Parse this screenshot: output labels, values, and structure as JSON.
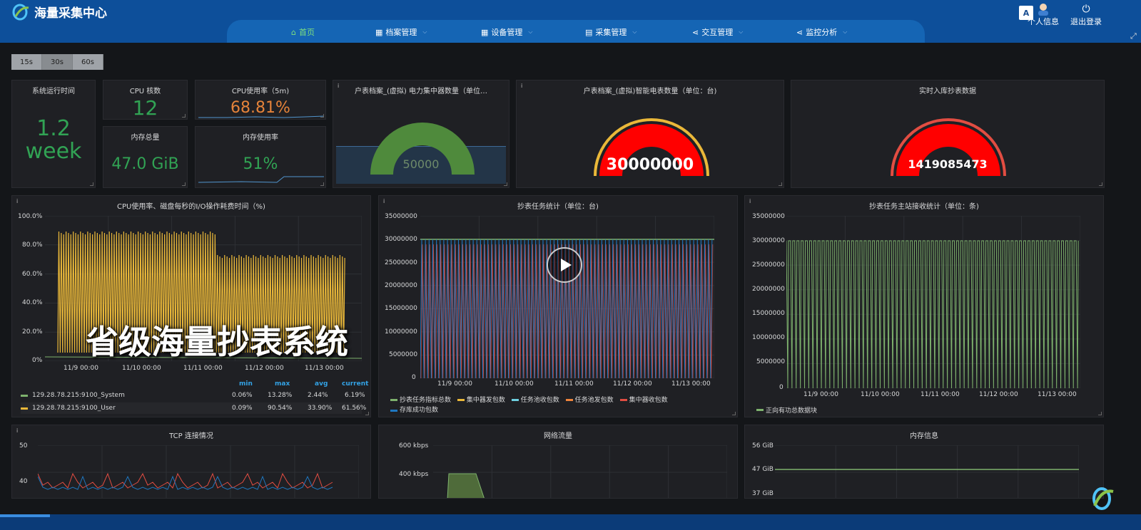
{
  "app": {
    "title": "海量采集中心"
  },
  "nav": [
    {
      "label": "首页",
      "active": true
    },
    {
      "label": "档案管理"
    },
    {
      "label": "设备管理"
    },
    {
      "label": "采集管理"
    },
    {
      "label": "交互管理"
    },
    {
      "label": "监控分析"
    }
  ],
  "topRight": {
    "translate": "A",
    "profile": "个人信息",
    "logout": "退出登录"
  },
  "ranges": [
    "15s",
    "30s",
    "60s"
  ],
  "stats": {
    "uptime": {
      "title": "系统运行时间",
      "value": "1.2 week",
      "line1": "1.2",
      "line2": "week"
    },
    "cpuCores": {
      "title": "CPU 核数",
      "value": "12"
    },
    "cpuUsage": {
      "title": "CPU使用率（5m)",
      "value": "68.81%"
    },
    "memTotal": {
      "title": "内存总量",
      "value": "47.0 GiB"
    },
    "memUsage": {
      "title": "内存使用率",
      "value": "51%"
    }
  },
  "gauges": {
    "concentrators": {
      "title": "户表档案_(虚拟) 电力集中器数量（单位…",
      "value": "50000",
      "color": "#4f8a3c"
    },
    "meters": {
      "title": "户表档案_(虚拟)智能电表数量（单位：台)",
      "value": "30000000",
      "color": "#ff0000"
    },
    "realtime": {
      "title": "实时入库抄表数据",
      "value": "1419085473",
      "color": "#ff0000"
    }
  },
  "cpuChart": {
    "title": "CPU使用率、磁盘每秒的I/O操作耗费时间（%)",
    "yTicks": [
      "100.0%",
      "80.0%",
      "60.0%",
      "40.0%",
      "20.0%",
      "0%"
    ],
    "xTicks": [
      "11/9 00:00",
      "11/10 00:00",
      "11/11 00:00",
      "11/12 00:00",
      "11/13 00:00"
    ],
    "legendHeader": [
      "min",
      "max",
      "avg",
      "current"
    ],
    "legend": [
      {
        "name": "129.28.78.215:9100_System",
        "min": "0.06%",
        "max": "13.28%",
        "avg": "2.44%",
        "current": "6.19%",
        "color": "#7eb26d"
      },
      {
        "name": "129.28.78.215:9100_User",
        "min": "0.09%",
        "max": "90.54%",
        "avg": "33.90%",
        "current": "61.56%",
        "color": "#eab839"
      }
    ]
  },
  "taskChart": {
    "title": "抄表任务统计（单位：台)",
    "yTicks": [
      "35000000",
      "30000000",
      "25000000",
      "20000000",
      "15000000",
      "10000000",
      "5000000",
      "0"
    ],
    "xTicks": [
      "11/9 00:00",
      "11/10 00:00",
      "11/11 00:00",
      "11/12 00:00",
      "11/13 00:00"
    ],
    "legend": [
      {
        "name": "抄表任务指标总数",
        "color": "#7eb26d"
      },
      {
        "name": "集中器发包数",
        "color": "#eab839"
      },
      {
        "name": "任务池收包数",
        "color": "#6ed0e0"
      },
      {
        "name": "任务池发包数",
        "color": "#ef843c"
      },
      {
        "name": "集中器收包数",
        "color": "#e24d42"
      },
      {
        "name": "存库成功包数",
        "color": "#1f78c1"
      }
    ]
  },
  "masterChart": {
    "title": "抄表任务主站接收统计（单位：条)",
    "yTicks": [
      "35000000",
      "30000000",
      "25000000",
      "20000000",
      "15000000",
      "10000000",
      "5000000",
      "0"
    ],
    "xTicks": [
      "11/9 00:00",
      "11/10 00:00",
      "11/11 00:00",
      "11/12 00:00",
      "11/13 00:00"
    ],
    "legend": [
      {
        "name": "正向有功总数据块",
        "color": "#7eb26d"
      }
    ]
  },
  "tcpChart": {
    "title": "TCP 连接情况",
    "yTicks": [
      "50",
      "40"
    ]
  },
  "netChart": {
    "title": "网络流量",
    "yTicks": [
      "600 kbps",
      "400 kbps"
    ]
  },
  "memChart": {
    "title": "内存信息",
    "yTicks": [
      "56 GiB",
      "47 GiB",
      "37 GiB"
    ]
  },
  "overlay": {
    "caption": "省级海量抄表系统"
  }
}
